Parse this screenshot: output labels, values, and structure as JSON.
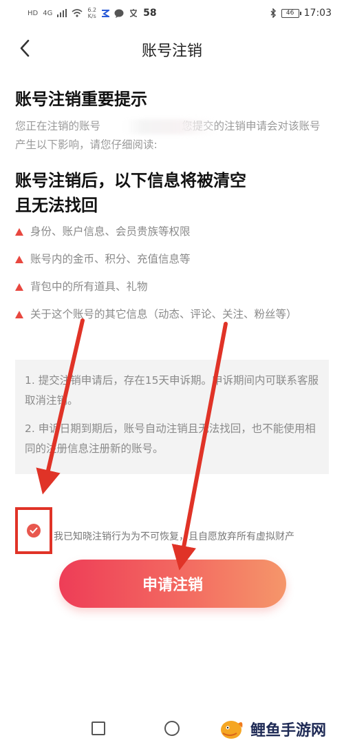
{
  "status_bar": {
    "hd": "HD",
    "signal": "4G",
    "speed_value": "6.2",
    "speed_unit": "K/s",
    "extra": "58",
    "battery": "46",
    "time": "17:03"
  },
  "header": {
    "title": "账号注销"
  },
  "main": {
    "heading": "账号注销重要提示",
    "intro_start": "您正在注销的账号",
    "intro_end": "您提交的注销申请会对该账号产生以下影响，请您仔细阅读:",
    "subheading_line1": "账号注销后，以下信息将被清空",
    "subheading_line2": "且无法找回",
    "bullets": [
      "身份、账户信息、会员贵族等权限",
      "账号内的金币、积分、充值信息等",
      "背包中的所有道具、礼物",
      "关于这个账号的其它信息（动态、评论、关注、粉丝等）"
    ],
    "notices": [
      "1. 提交注销申请后，存在15天申诉期。申诉期间内可联系客服取消注销。",
      "2. 申诉日期到期后，账号自动注销且无法找回，也不能使用相同的注册信息注册新的账号。"
    ]
  },
  "agreement": {
    "text": "我已知晓注销行为为不可恢复，且自愿放弃所有虚拟财产",
    "checked": true
  },
  "action": {
    "apply_label": "申请注销"
  },
  "watermark": {
    "text": "鲤鱼手游网"
  },
  "colors": {
    "accent": "#e8473f",
    "button_start": "#ee3d57",
    "button_end": "#f5966a",
    "annotation_red": "#e03327"
  }
}
